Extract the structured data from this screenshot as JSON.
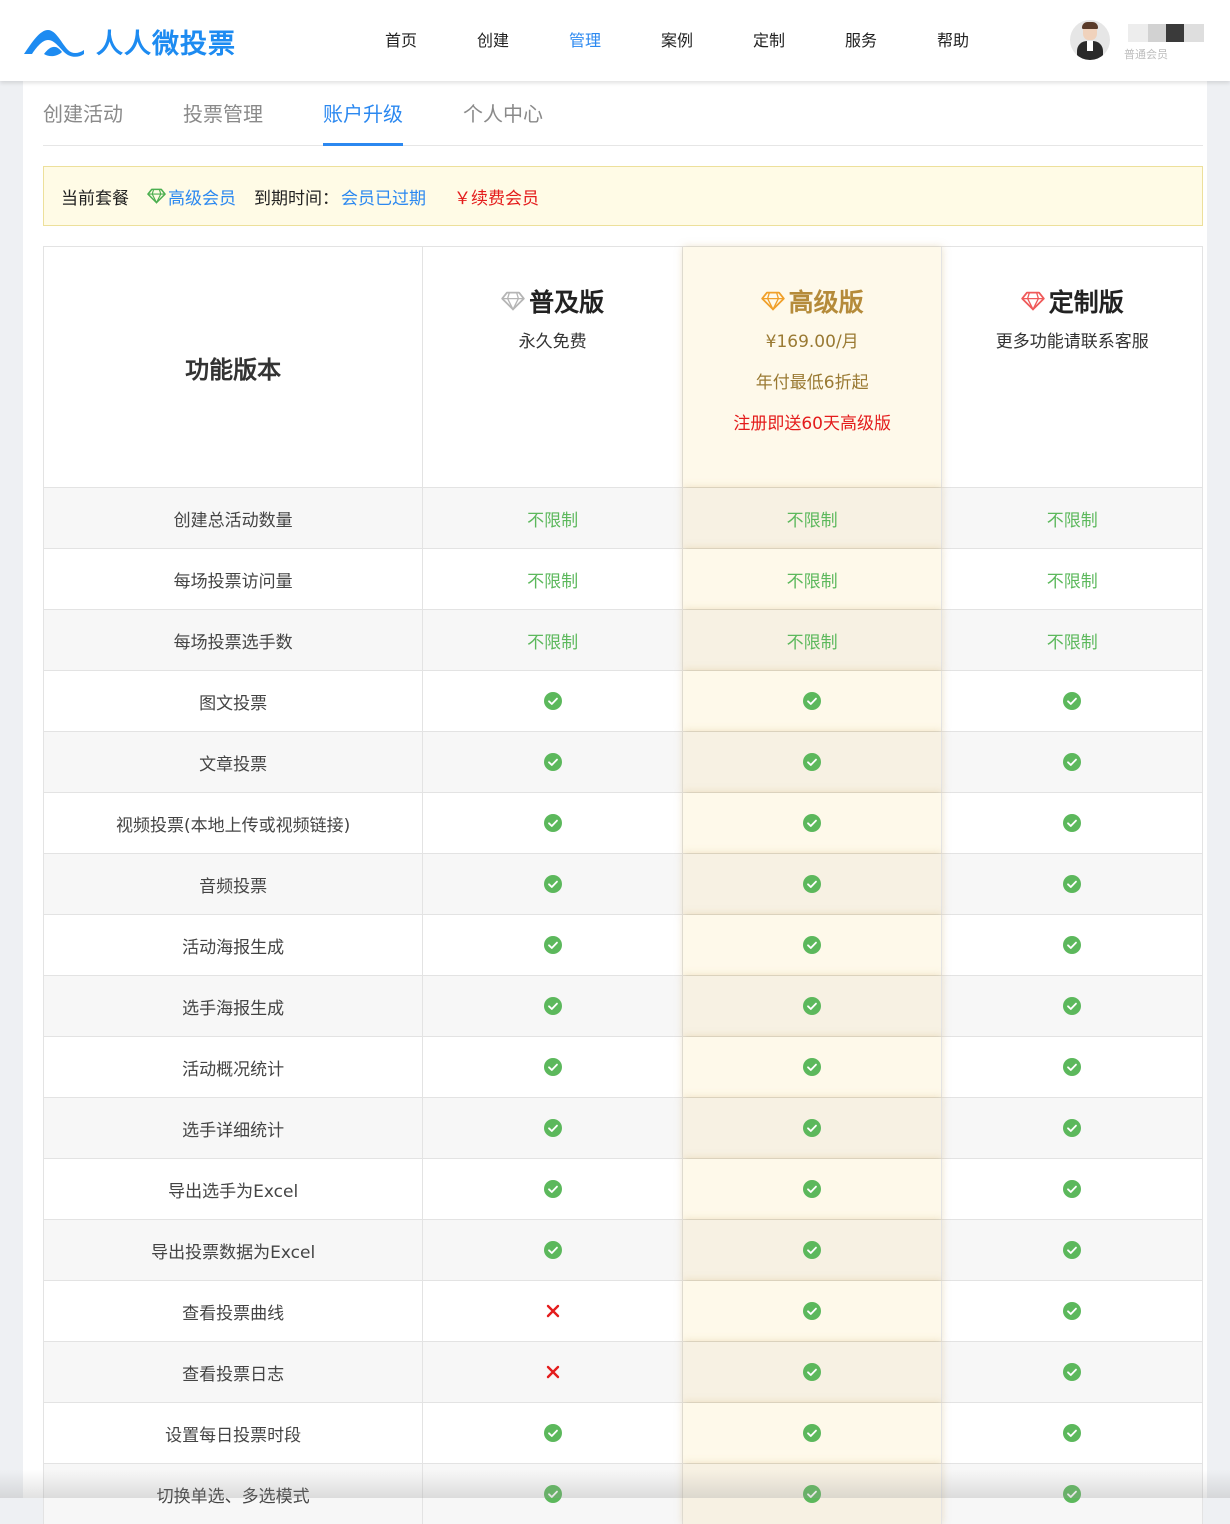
{
  "brand": {
    "name": "人人微投票",
    "color": "#1d8bf1"
  },
  "nav": [
    {
      "label": "首页",
      "active": false
    },
    {
      "label": "创建",
      "active": false
    },
    {
      "label": "管理",
      "active": true
    },
    {
      "label": "案例",
      "active": false
    },
    {
      "label": "定制",
      "active": false
    },
    {
      "label": "服务",
      "active": false
    },
    {
      "label": "帮助",
      "active": false
    }
  ],
  "user": {
    "level": "普通会员"
  },
  "tabs": [
    {
      "label": "创建活动",
      "active": false
    },
    {
      "label": "投票管理",
      "active": false
    },
    {
      "label": "账户升级",
      "active": true
    },
    {
      "label": "个人中心",
      "active": false
    }
  ],
  "plan_bar": {
    "current_label": "当前套餐",
    "current_plan": "高级会员",
    "expire_label": "到期时间：",
    "expire_value": "会员已过期",
    "renew_label": "￥续费会员"
  },
  "comparison": {
    "header_label": "功能版本",
    "plans": [
      {
        "name": "普及版",
        "gem": "gray-diamond-icon",
        "sub": "永久免费"
      },
      {
        "name": "高级版",
        "gem": "gold-diamond-icon",
        "sub": "¥169.00/月",
        "sub2": "年付最低6折起",
        "sub3": "注册即送60天高级版"
      },
      {
        "name": "定制版",
        "gem": "red-diamond-icon",
        "sub": "更多功能请联系客服"
      }
    ],
    "unlimited_text": "不限制",
    "rows": [
      {
        "feature": "创建总活动数量",
        "values": [
          "unlimited",
          "unlimited",
          "unlimited"
        ]
      },
      {
        "feature": "每场投票访问量",
        "values": [
          "unlimited",
          "unlimited",
          "unlimited"
        ]
      },
      {
        "feature": "每场投票选手数",
        "values": [
          "unlimited",
          "unlimited",
          "unlimited"
        ]
      },
      {
        "feature": "图文投票",
        "values": [
          "yes",
          "yes",
          "yes"
        ]
      },
      {
        "feature": "文章投票",
        "values": [
          "yes",
          "yes",
          "yes"
        ]
      },
      {
        "feature": "视频投票(本地上传或视频链接)",
        "values": [
          "yes",
          "yes",
          "yes"
        ]
      },
      {
        "feature": "音频投票",
        "values": [
          "yes",
          "yes",
          "yes"
        ]
      },
      {
        "feature": "活动海报生成",
        "values": [
          "yes",
          "yes",
          "yes"
        ]
      },
      {
        "feature": "选手海报生成",
        "values": [
          "yes",
          "yes",
          "yes"
        ]
      },
      {
        "feature": "活动概况统计",
        "values": [
          "yes",
          "yes",
          "yes"
        ]
      },
      {
        "feature": "选手详细统计",
        "values": [
          "yes",
          "yes",
          "yes"
        ]
      },
      {
        "feature": "导出选手为Excel",
        "values": [
          "yes",
          "yes",
          "yes"
        ]
      },
      {
        "feature": "导出投票数据为Excel",
        "values": [
          "yes",
          "yes",
          "yes"
        ]
      },
      {
        "feature": "查看投票曲线",
        "values": [
          "no",
          "yes",
          "yes"
        ]
      },
      {
        "feature": "查看投票日志",
        "values": [
          "no",
          "yes",
          "yes"
        ]
      },
      {
        "feature": "设置每日投票时段",
        "values": [
          "yes",
          "yes",
          "yes"
        ]
      },
      {
        "feature": "切换单选、多选模式",
        "values": [
          "yes",
          "yes",
          "yes"
        ]
      }
    ]
  },
  "colors": {
    "accent": "#2b88f0",
    "unlimited": "#5cb85c",
    "check": "#5cb85c",
    "cross": "#e41c1c",
    "renew": "#e41c1c",
    "highlight_bg": "#fef9ea"
  }
}
